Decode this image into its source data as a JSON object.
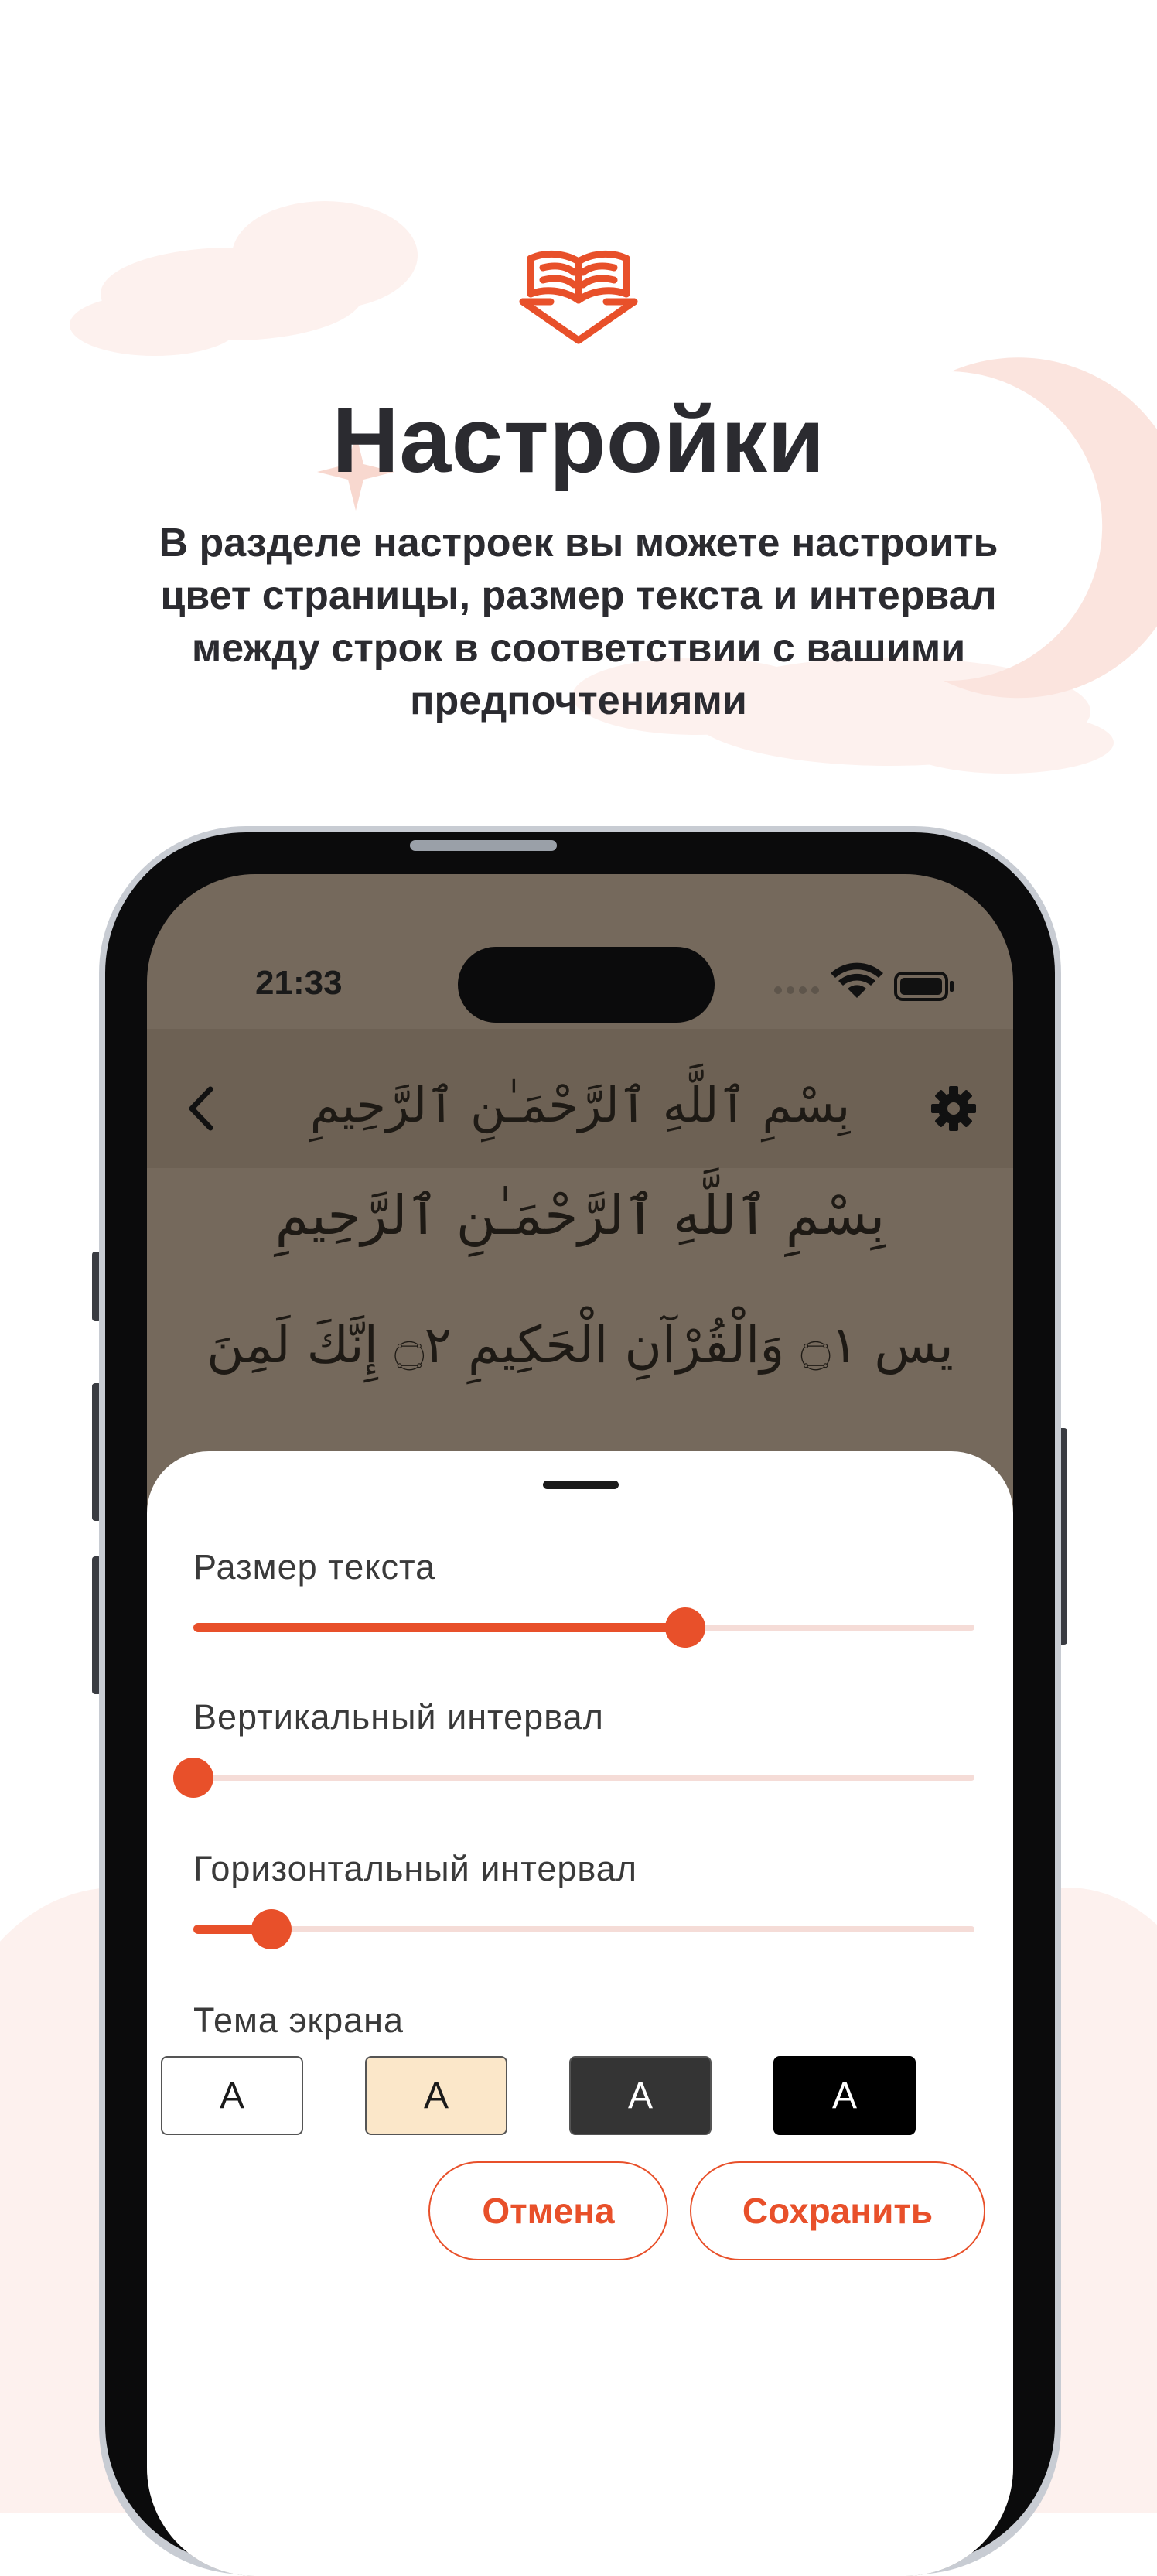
{
  "promo": {
    "title": "Настройки",
    "subtitle": "В разделе настроек вы можете настроить цвет страницы, размер текста и интервал между строк в соответствии с вашими предпочтениями"
  },
  "status_bar": {
    "time": "21:33"
  },
  "reader": {
    "nav_title": "بِسْمِ ٱللَّهِ ٱلرَّحْمَـٰنِ ٱلرَّحِيمِ",
    "bismillah": "بِسْمِ ٱللَّهِ ٱلرَّحْمَـٰنِ ٱلرَّحِيمِ",
    "verse_line": "يس ۝١ وَالْقُرْآنِ الْحَكِيمِ ۝٢ إِنَّكَ لَمِنَ"
  },
  "settings": {
    "text_size_label": "Размер текста",
    "text_size_value": 0.63,
    "vertical_label": "Вертикальный интервал",
    "vertical_value": 0.0,
    "horizontal_label": "Горизонтальный интервал",
    "horizontal_value": 0.1,
    "theme_label": "Тема экрана",
    "themes": [
      {
        "label": "A",
        "bg": "#ffffff",
        "fg": "#1a1a1a"
      },
      {
        "label": "A",
        "bg": "#fbe7c9",
        "fg": "#1a1a1a"
      },
      {
        "label": "A",
        "bg": "#343434",
        "fg": "#ffffff"
      },
      {
        "label": "A",
        "bg": "#000000",
        "fg": "#ffffff"
      }
    ],
    "cancel_label": "Отмена",
    "save_label": "Сохранить"
  },
  "colors": {
    "accent": "#e8502a",
    "text_dark": "#2b2b30",
    "reader_bg": "#75695c"
  },
  "icons": [
    "quran-book-icon",
    "back-chevron-icon",
    "gear-icon",
    "signal-icon",
    "wifi-icon",
    "battery-icon"
  ]
}
